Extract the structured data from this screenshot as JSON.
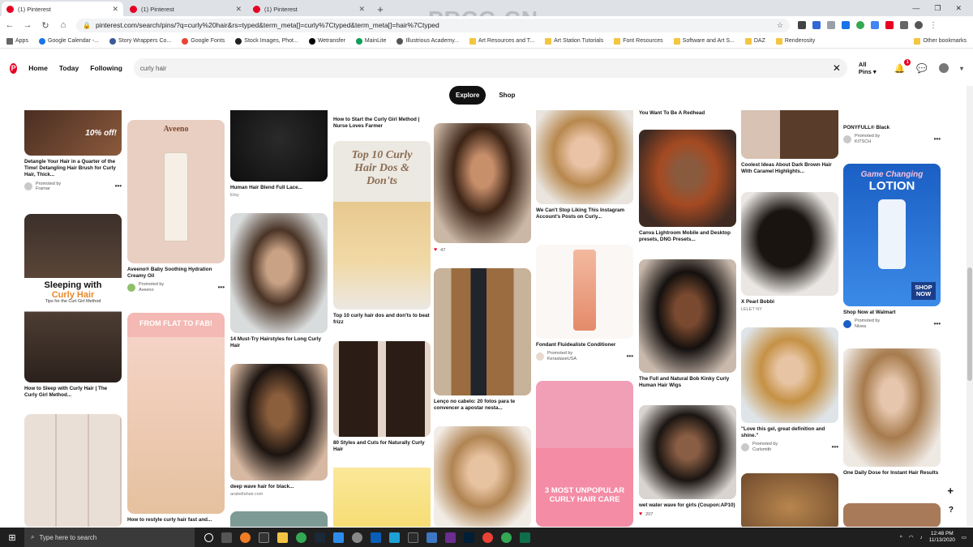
{
  "browser": {
    "tabs": [
      {
        "label": "(1) Pinterest",
        "active": true
      },
      {
        "label": "(1) Pinterest",
        "active": false
      },
      {
        "label": "(1) Pinterest",
        "active": false
      }
    ],
    "url": "pinterest.com/search/pins/?q=curly%20hair&rs=typed&term_meta[]=curly%7Ctyped&term_meta[]=hair%7Ctyped",
    "bookmarks": [
      "Apps",
      "Google Calendar -...",
      "Story Wrappers Co...",
      "Google Fonts",
      "Stock Images, Phot...",
      "Wetransfer",
      "MainLite",
      "Illustrious Academy...",
      "Art Resources and T...",
      "Art Station Tutorials",
      "Font Resources",
      "Software and Art S...",
      "DAZ",
      "Renderosity"
    ],
    "other_bookmarks": "Other bookmarks",
    "watermark": "PRCG.CN"
  },
  "header": {
    "nav": [
      "Home",
      "Today",
      "Following"
    ],
    "search_value": "curly hair",
    "filter": "All Pins",
    "notif_count": "1"
  },
  "tabs": {
    "explore": "Explore",
    "shop": "Shop"
  },
  "pins": {
    "c1": [
      {
        "title": "Detangle Your Hair in a Quarter of the Time! Detangling Hair Brush for Curly Hair, Thick...",
        "promoted": "Promoted by",
        "by": "Framar",
        "overlay": "10% off!"
      },
      {
        "title": "How to Sleep with Curly Hair | The Curly Girl Method...",
        "overlay": "Sleeping with",
        "overlay2": "Curly Hair",
        "overlay3": "Tips for the Curl Girl Method"
      },
      {
        "title": ""
      }
    ],
    "c2": [
      {
        "title": "Aveeno® Baby Soothing Hydration Creamy Oil",
        "promoted": "Promoted by",
        "by": "Aveeno",
        "overlay": "Aveeno"
      },
      {
        "title": "How to restyle curly hair fast and...",
        "overlay": "FROM FLAT TO FAB!"
      }
    ],
    "c3": [
      {
        "title": "Human Hair Blend Full Lace...",
        "sub": "Etsy"
      },
      {
        "title": "14 Must-Try Hairstyles for Long Curly Hair"
      },
      {
        "title": "deep wave hair for black...",
        "sub": "arabellahair.com"
      }
    ],
    "c4": [
      {
        "title": "How to Start the Curly Girl Method | Nurse Loves Farmer"
      },
      {
        "title": "Top 10 curly hair dos and don'ts to beat frizz",
        "overlay": "Top 10 Curly Hair Dos & Don'ts"
      },
      {
        "title": "80 Styles and Cuts for Naturally Curly Hair"
      }
    ],
    "c5": [
      {
        "title": "",
        "likes": "47"
      },
      {
        "title": "Lenço no cabelo: 20 fotos para te convencer a apostar nesta..."
      }
    ],
    "c6": [
      {
        "title": "We Can't Stop Liking This Instagram Account's Posts on Curly..."
      },
      {
        "title": "Fondant Fluidealiste Conditioner",
        "promoted": "Promoted by",
        "by": "KerastaseUSA"
      },
      {
        "title": "",
        "overlay": "3 MOST UNPOPULAR CURLY HAIR CARE"
      }
    ],
    "c7": [
      {
        "title": "You Want To Be A Redhead"
      },
      {
        "title": "Canva Lightroom Mobile and Desktop presets, DNG Presets..."
      },
      {
        "title": "The Full and Natural Bob Kinky Curly Human Hair Wigs"
      },
      {
        "title": "wet water wave for girls (Coupon:AP10)",
        "likes": "207"
      }
    ],
    "c8": [
      {
        "title": "Coolest Ideas About Dark Brown Hair With Caramel Highlights..."
      },
      {
        "title": "X Pearl Bobbi",
        "sub": "LELET NY"
      },
      {
        "title": "\"Love this gel, great definition and shine.\"",
        "promoted": "Promoted by",
        "by": "Curlsmith"
      }
    ],
    "c9": [
      {
        "title": "PONYFULL® Black",
        "promoted": "Promoted by",
        "by": "KITSCH"
      },
      {
        "title": "Shop Now at Walmart",
        "promoted": "Promoted by",
        "by": "Nivea",
        "overlay": "Game Changing",
        "overlay2": "LOTION",
        "overlay3": "SHOP NOW"
      },
      {
        "title": "One Daily Dose for Instant Hair Results"
      }
    ]
  },
  "taskbar": {
    "search_placeholder": "Type here to search",
    "time": "12:48 PM",
    "date": "11/13/2020"
  }
}
